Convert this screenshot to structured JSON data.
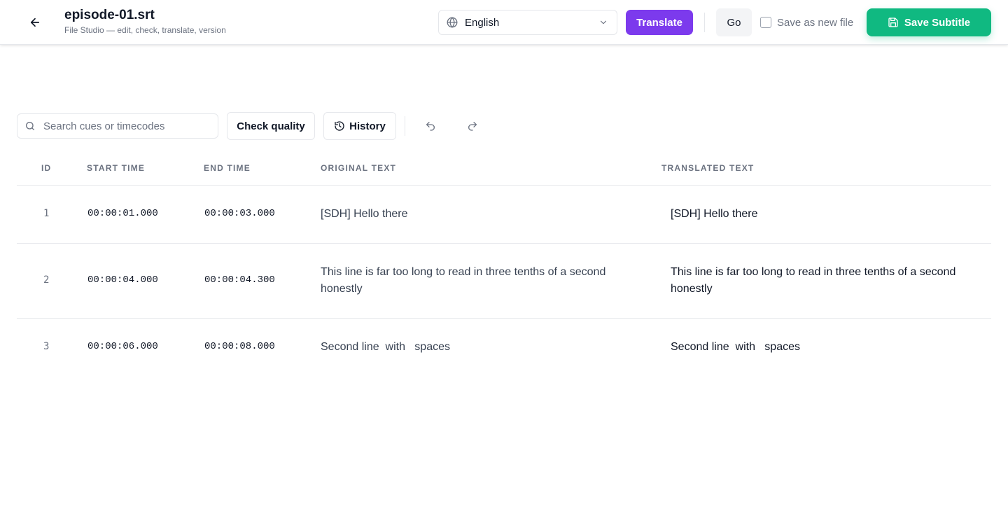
{
  "header": {
    "title": "episode-01.srt",
    "subtitle": "File Studio — edit, check, translate, version",
    "language": "English",
    "translate_label": "Translate",
    "go_label": "Go",
    "save_new_label": "Save as new file",
    "save_label": "Save Subtitle"
  },
  "toolbar": {
    "search_placeholder": "Search cues or timecodes",
    "check_label": "Check quality",
    "history_label": "History"
  },
  "table": {
    "columns": [
      "ID",
      "START TIME",
      "END TIME",
      "ORIGINAL TEXT",
      "TRANSLATED TEXT"
    ],
    "rows": [
      {
        "id": "1",
        "start": "00:00:01.000",
        "end": "00:00:03.000",
        "original": "[SDH] Hello there",
        "translated": "[SDH] Hello there"
      },
      {
        "id": "2",
        "start": "00:00:04.000",
        "end": "00:00:04.300",
        "original": "This line is far too long to read in three tenths of a second honestly",
        "translated": "This line is far too long to read in three tenths of a second honestly"
      },
      {
        "id": "3",
        "start": "00:00:06.000",
        "end": "00:00:08.000",
        "original": "Second line  with   spaces",
        "translated": "Second line  with   spaces"
      }
    ]
  },
  "colors": {
    "accent_purple": "#7c3aed",
    "accent_green": "#10b981"
  },
  "icons": [
    "arrow-left-icon",
    "globe-icon",
    "chevron-down-icon",
    "save-icon",
    "search-icon",
    "history-icon",
    "undo-icon",
    "redo-icon"
  ]
}
